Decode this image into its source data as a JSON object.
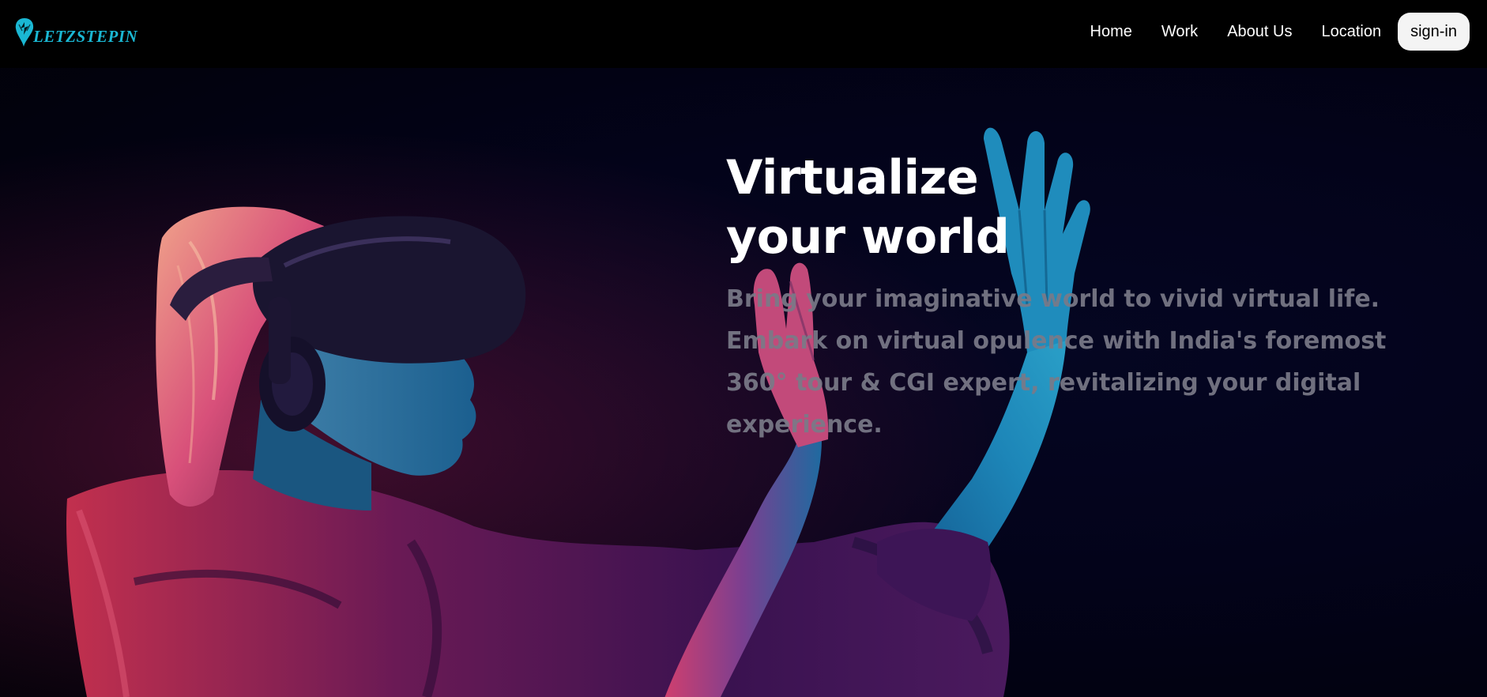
{
  "brand": {
    "name": "LETZSTEPIN",
    "color": "#1ab7d3"
  },
  "nav": {
    "links": [
      "Home",
      "Work",
      "About Us",
      "Location"
    ],
    "signin_label": "sign-in"
  },
  "hero": {
    "title_line1": "Virtualize",
    "title_line2": "your world",
    "description": "Bring your imaginative world to vivid virtual life. Embark on virtual opulence with India's foremost 360° tour & CGI expert, revitalizing your digital experience."
  },
  "colors": {
    "background": "#000000",
    "nav_text": "#ffffff",
    "button_bg": "#f4f4f4",
    "hero_desc": "#7a7a88",
    "accent_pink": "#ff2d6a",
    "accent_blue": "#1a8cff"
  }
}
